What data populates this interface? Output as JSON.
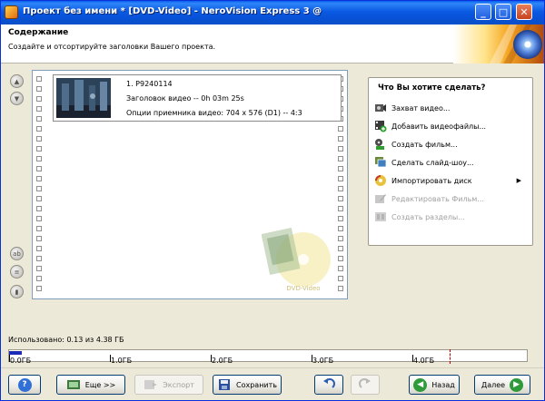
{
  "window": {
    "title": "Проект без имени * [DVD-Video] - NeroVision Express 3 @",
    "minimize_glyph": "_",
    "maximize_glyph": "□",
    "close_glyph": "✕"
  },
  "header": {
    "title": "Содержание",
    "subtitle": "Создайте и отсортируйте заголовки Вашего проекта."
  },
  "titles_list": {
    "items": [
      {
        "name": "1.  P9240114",
        "duration": "Заголовок видео -- 0h 03m 25s",
        "options": "Опции приемника видео: 704 x 576 (D1) -- 4:3"
      }
    ],
    "watermark_text": "DVD-Video"
  },
  "actions_panel": {
    "title": "Что Вы хотите сделать?",
    "items": [
      {
        "label": "Захват видео...",
        "icon": "capture-icon",
        "enabled": true
      },
      {
        "label": "Добавить видеофайлы...",
        "icon": "add-files-icon",
        "enabled": true
      },
      {
        "label": "Создать фильм...",
        "icon": "make-movie-icon",
        "enabled": true
      },
      {
        "label": "Сделать слайд-шоу...",
        "icon": "slideshow-icon",
        "enabled": true
      },
      {
        "label": "Импортировать диск",
        "icon": "import-disc-icon",
        "enabled": true,
        "submenu_arrow": "▶"
      },
      {
        "label": "Редактировать Фильм...",
        "icon": "edit-movie-icon",
        "enabled": false
      },
      {
        "label": "Создать разделы...",
        "icon": "chapters-icon",
        "enabled": false
      }
    ]
  },
  "usage": {
    "label": "Использовано: 0.13 из 4.38 ГБ",
    "used_gb": 0.13,
    "capacity_gb": 4.38,
    "scale_labels": [
      "0.0ГБ",
      "1.0ГБ",
      "2.0ГБ",
      "3.0ГБ",
      "4.0ГБ"
    ]
  },
  "buttons": {
    "help": "?",
    "more": "Еще >>",
    "export": "Экспорт",
    "save": "Сохранить",
    "back": "Назад",
    "next": "Далее"
  },
  "colors": {
    "usage_fill": "#1b2bb8",
    "limit_marker": "#c00000",
    "xp_blue": "#0a5ae2"
  }
}
